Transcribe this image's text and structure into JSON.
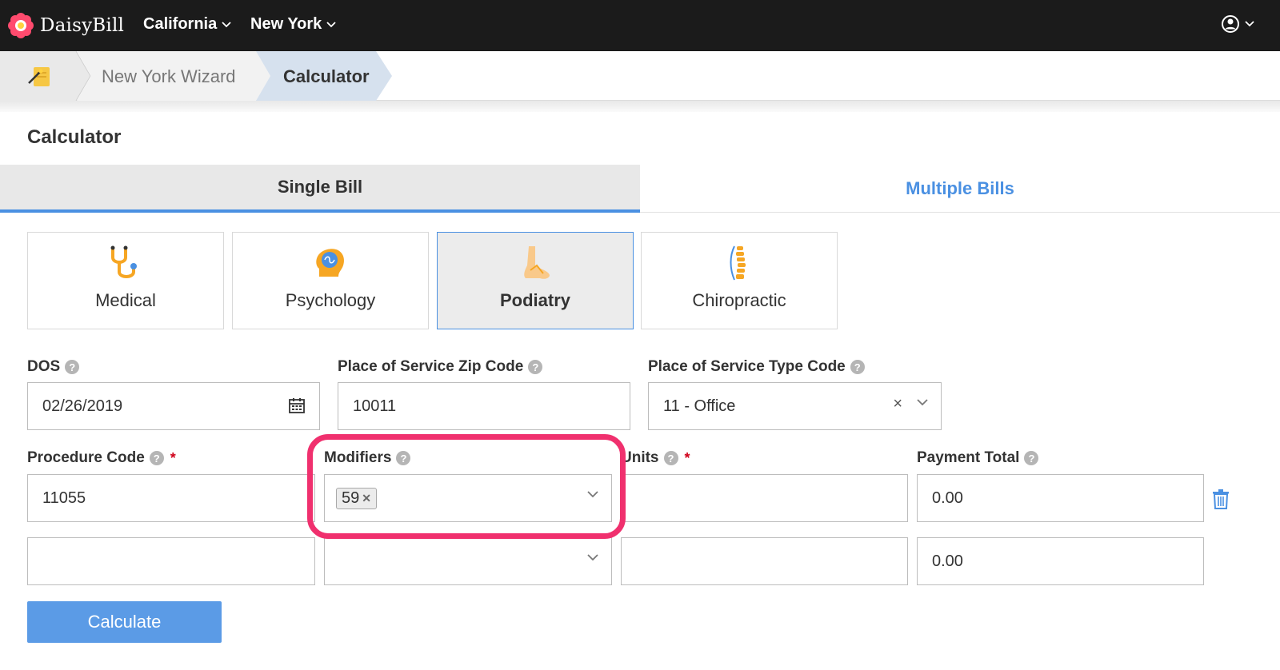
{
  "brand": {
    "name": "DaisyBill"
  },
  "nav": {
    "items": [
      {
        "label": "California"
      },
      {
        "label": "New York"
      }
    ]
  },
  "breadcrumb": {
    "items": [
      {
        "label": "New York Wizard"
      },
      {
        "label": "Calculator"
      }
    ]
  },
  "page": {
    "title": "Calculator"
  },
  "tabs": {
    "single": "Single Bill",
    "multiple": "Multiple Bills",
    "active": "Single Bill"
  },
  "specialties": {
    "selected": "Podiatry",
    "items": [
      {
        "label": "Medical",
        "icon": "stethoscope-icon"
      },
      {
        "label": "Psychology",
        "icon": "brain-icon"
      },
      {
        "label": "Podiatry",
        "icon": "foot-icon"
      },
      {
        "label": "Chiropractic",
        "icon": "spine-icon"
      }
    ]
  },
  "form": {
    "dos": {
      "label": "DOS",
      "value": "02/26/2019"
    },
    "zip": {
      "label": "Place of Service Zip Code",
      "value": "10011"
    },
    "pos_type": {
      "label": "Place of Service Type Code",
      "value": "11 - Office"
    },
    "procedure": {
      "label": "Procedure Code",
      "required_mark": "*"
    },
    "modifiers": {
      "label": "Modifiers"
    },
    "units": {
      "label": "Units",
      "required_mark": "*"
    },
    "payment": {
      "label": "Payment Total"
    },
    "rows": [
      {
        "procedure": "11055",
        "modifier_tag": "59",
        "units": "",
        "payment": "0.00"
      },
      {
        "procedure": "",
        "modifier_tag": "",
        "units": "",
        "payment": "0.00"
      }
    ]
  },
  "actions": {
    "calculate": "Calculate"
  },
  "colors": {
    "accent": "#4a90e2",
    "button": "#5b9be6",
    "highlight": "#f0306e",
    "topbar": "#1b1b1b"
  }
}
